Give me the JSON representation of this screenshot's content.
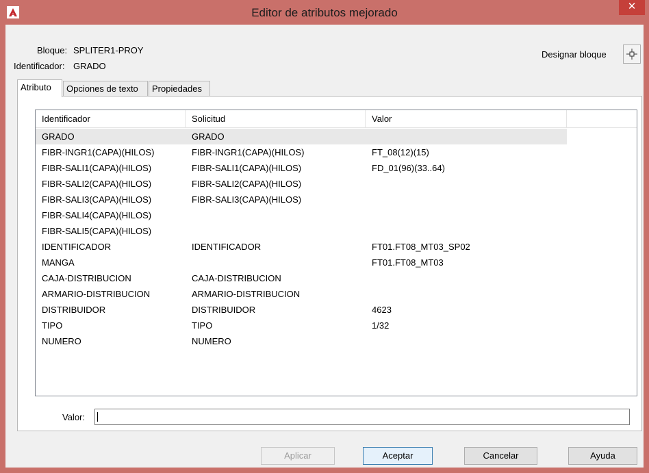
{
  "window": {
    "title": "Editor de atributos mejorado",
    "close_symbol": "✕",
    "accent_color": "#c9706a"
  },
  "header": {
    "block_label": "Bloque:",
    "block_value": "SPLITER1-PROY",
    "tag_label": "Identificador:",
    "tag_value": "GRADO",
    "select_block_label": "Designar bloque",
    "select_block_icon": "crosshair-icon"
  },
  "tabs": [
    {
      "label": "Atributo",
      "active": true
    },
    {
      "label": "Opciones de texto",
      "active": false
    },
    {
      "label": "Propiedades",
      "active": false
    }
  ],
  "grid": {
    "columns": [
      "Identificador",
      "Solicitud",
      "Valor"
    ],
    "rows": [
      {
        "tag": "GRADO",
        "prompt": "GRADO",
        "value": "",
        "selected": true
      },
      {
        "tag": "FIBR-INGR1(CAPA)(HILOS)",
        "prompt": "FIBR-INGR1(CAPA)(HILOS)",
        "value": "FT_08(12)(15)"
      },
      {
        "tag": "FIBR-SALI1(CAPA)(HILOS)",
        "prompt": "FIBR-SALI1(CAPA)(HILOS)",
        "value": "FD_01(96)(33..64)"
      },
      {
        "tag": "FIBR-SALI2(CAPA)(HILOS)",
        "prompt": "FIBR-SALI2(CAPA)(HILOS)",
        "value": ""
      },
      {
        "tag": "FIBR-SALI3(CAPA)(HILOS)",
        "prompt": "FIBR-SALI3(CAPA)(HILOS)",
        "value": ""
      },
      {
        "tag": "FIBR-SALI4(CAPA)(HILOS)",
        "prompt": "",
        "value": ""
      },
      {
        "tag": "FIBR-SALI5(CAPA)(HILOS)",
        "prompt": "",
        "value": ""
      },
      {
        "tag": "IDENTIFICADOR",
        "prompt": "IDENTIFICADOR",
        "value": "FT01.FT08_MT03_SP02"
      },
      {
        "tag": "MANGA",
        "prompt": "",
        "value": "FT01.FT08_MT03"
      },
      {
        "tag": "CAJA-DISTRIBUCION",
        "prompt": "CAJA-DISTRIBUCION",
        "value": ""
      },
      {
        "tag": "ARMARIO-DISTRIBUCION",
        "prompt": "ARMARIO-DISTRIBUCION",
        "value": ""
      },
      {
        "tag": "DISTRIBUIDOR",
        "prompt": "DISTRIBUIDOR",
        "value": "4623"
      },
      {
        "tag": "TIPO",
        "prompt": "TIPO",
        "value": "1/32"
      },
      {
        "tag": "NUMERO",
        "prompt": "NUMERO",
        "value": ""
      }
    ]
  },
  "value_field": {
    "label": "Valor:",
    "value": ""
  },
  "buttons": {
    "apply": "Aplicar",
    "ok": "Aceptar",
    "cancel": "Cancelar",
    "help": "Ayuda"
  }
}
